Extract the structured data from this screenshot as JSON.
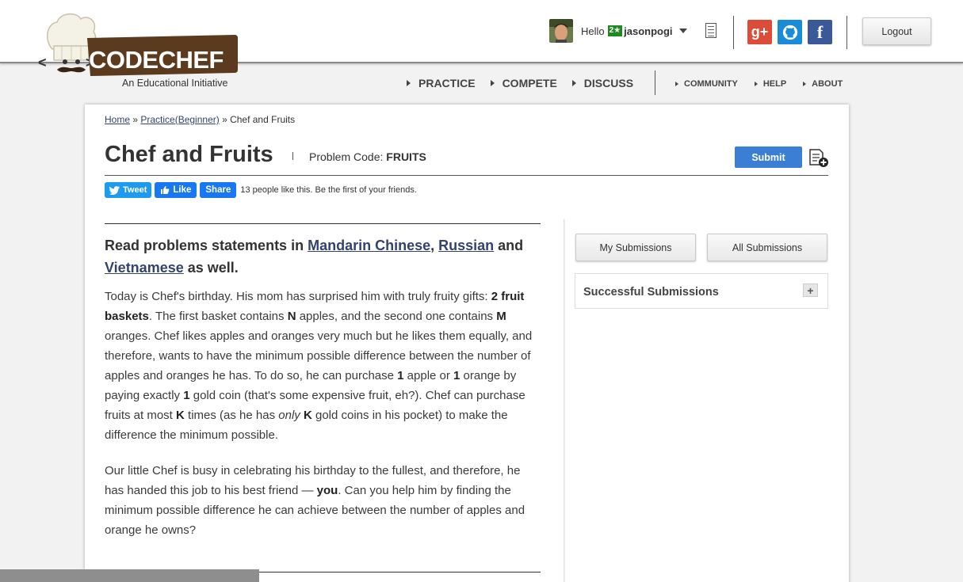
{
  "brand": {
    "logo_text": "CODECHEF",
    "tagline": "An Educational Initiative"
  },
  "user": {
    "greeting": "Hello",
    "star_badge": "2★",
    "username": "jasonpogi"
  },
  "social": {
    "google_label": "g+",
    "facebook_label": "f"
  },
  "header": {
    "logout_label": "Logout"
  },
  "nav": {
    "main": [
      "PRACTICE",
      "COMPETE",
      "DISCUSS"
    ],
    "secondary": [
      "COMMUNITY",
      "HELP",
      "ABOUT"
    ]
  },
  "breadcrumb": {
    "home": "Home",
    "sep1": " » ",
    "practice": "Practice(Beginner)",
    "sep2": " » ",
    "current": "Chef and Fruits"
  },
  "problem": {
    "title": "Chef and Fruits",
    "code_label": "Problem Code: ",
    "code": "FRUITS",
    "submit_label": "Submit"
  },
  "share": {
    "tweet_label": "Tweet",
    "like_label": "Like",
    "share_label": "Share",
    "like_text": "13 people like this. Be the first of your friends."
  },
  "statement": {
    "langs_prefix": "Read problems statements in ",
    "lang1": "Mandarin Chinese",
    "comma": ", ",
    "lang2": "Russian",
    "and": " and ",
    "lang3": "Vietnamese",
    "suffix": " as well.",
    "p1": {
      "t1": "Today is Chef's birthday. His mom has surprised him with truly fruity gifts: ",
      "b1": "2 fruit baskets",
      "t2": ". The first basket contains ",
      "b2": "N",
      "t3": " apples, and the second one contains ",
      "b3": "M",
      "t4": " oranges. Chef likes apples and oranges very much but he likes them equally, and therefore, wants to have the minimum possible difference between the number of apples and oranges he has. To do so, he can purchase ",
      "b4": "1",
      "t5": " apple or ",
      "b5": "1",
      "t6": " orange by paying exactly ",
      "b6": "1",
      "t7": " gold coin (that's some expensive fruit, eh?). Chef can purchase fruits at most ",
      "b7": "K",
      "t8": " times (as he has ",
      "i1": "only",
      "t9": " ",
      "b8": "K",
      "t10": " gold coins in his pocket) to make the difference the minimum possible."
    },
    "p2": {
      "t1": "Our little Chef is busy in celebrating his birthday to the fullest, and therefore, he has handed this job to his best friend — ",
      "b1": "you",
      "t2": ". Can you help him by finding the minimum possible difference he can achieve between the number of apples and orange he owns?"
    }
  },
  "sidebar": {
    "my_submissions": "My Submissions",
    "all_submissions": "All Submissions",
    "successful_title": "Successful Submissions",
    "expand_label": "+"
  },
  "colors": {
    "submit_blue": "#3a7fd5",
    "link_blue": "#33436e",
    "google_red": "#dd4b39",
    "github_blue": "#1a8bd6",
    "facebook_blue": "#3b5998",
    "logo_brown": "#5b3a1e"
  }
}
